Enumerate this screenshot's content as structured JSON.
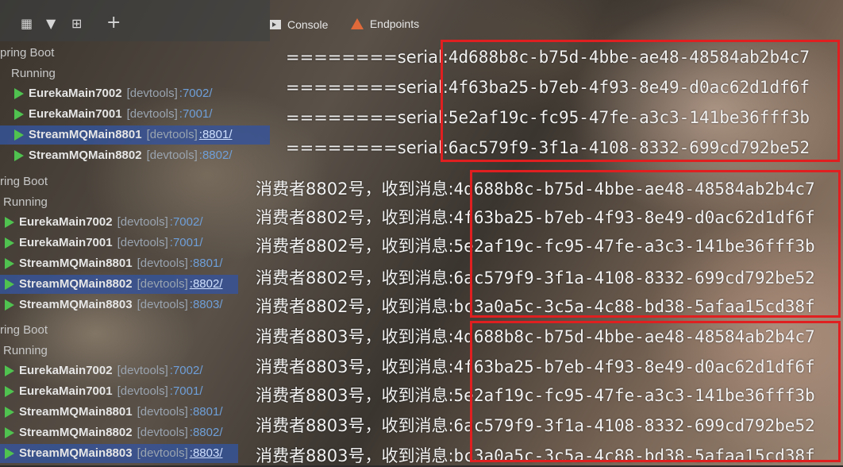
{
  "tabs": {
    "console": "Console",
    "endpoints": "Endpoints"
  },
  "toolbar_icons": [
    "layout-icon",
    "filter-icon",
    "add-config-icon",
    "plus-icon"
  ],
  "toolbar": {
    "plus_glyph": "+"
  },
  "panel1": {
    "group": "pring Boot",
    "running": "Running",
    "items": [
      {
        "name": "EurekaMain7002",
        "dev": "[devtools]",
        "port": ":7002/",
        "selected": false
      },
      {
        "name": "EurekaMain7001",
        "dev": "[devtools]",
        "port": ":7001/",
        "selected": false
      },
      {
        "name": "StreamMQMain8801",
        "dev": "[devtools]",
        "port": ":8801/",
        "selected": true
      },
      {
        "name": "StreamMQMain8802",
        "dev": "[devtools]",
        "port": ":8802/",
        "selected": false
      }
    ]
  },
  "panel2": {
    "group": "ring Boot",
    "running": "Running",
    "items": [
      {
        "name": "EurekaMain7002",
        "dev": "[devtools]",
        "port": ":7002/",
        "selected": false
      },
      {
        "name": "EurekaMain7001",
        "dev": "[devtools]",
        "port": ":7001/",
        "selected": false
      },
      {
        "name": "StreamMQMain8801",
        "dev": "[devtools]",
        "port": ":8801/",
        "selected": false
      },
      {
        "name": "StreamMQMain8802",
        "dev": "[devtools]",
        "port": ":8802/",
        "selected": true
      },
      {
        "name": "StreamMQMain8803",
        "dev": "[devtools]",
        "port": ":8803/",
        "selected": false
      }
    ]
  },
  "panel3": {
    "group": "ring Boot",
    "running": "Running",
    "items": [
      {
        "name": "EurekaMain7002",
        "dev": "[devtools]",
        "port": ":7002/",
        "selected": false
      },
      {
        "name": "EurekaMain7001",
        "dev": "[devtools]",
        "port": ":7001/",
        "selected": false
      },
      {
        "name": "StreamMQMain8801",
        "dev": "[devtools]",
        "port": ":8801/",
        "selected": false
      },
      {
        "name": "StreamMQMain8802",
        "dev": "[devtools]",
        "port": ":8802/",
        "selected": false
      },
      {
        "name": "StreamMQMain8803",
        "dev": "[devtools]",
        "port": ":8803/",
        "selected": true
      }
    ]
  },
  "section1": {
    "prefix": "========serial:",
    "values": [
      "4d688b8c-b75d-4bbe-ae48-48584ab2b4c7",
      "4f63ba25-b7eb-4f93-8e49-d0ac62d1df6f",
      "5e2af19c-fc95-47fe-a3c3-141be36fff3b",
      "6ac579f9-3f1a-4108-8332-699cd792be52"
    ]
  },
  "section2": {
    "prefix": "消费者8802号，收到消息:",
    "values": [
      "4d688b8c-b75d-4bbe-ae48-48584ab2b4c7",
      "4f63ba25-b7eb-4f93-8e49-d0ac62d1df6f",
      "5e2af19c-fc95-47fe-a3c3-141be36fff3b",
      "6ac579f9-3f1a-4108-8332-699cd792be52",
      "bc3a0a5c-3c5a-4c88-bd38-5afaa15cd38f"
    ]
  },
  "section3": {
    "prefix": "消费者8803号，收到消息:",
    "values": [
      "4d688b8c-b75d-4bbe-ae48-48584ab2b4c7",
      "4f63ba25-b7eb-4f93-8e49-d0ac62d1df6f",
      "5e2af19c-fc95-47fe-a3c3-141be36fff3b",
      "6ac579f9-3f1a-4108-8332-699cd792be52",
      "bc3a0a5c-3c5a-4c88-bd38-5afaa15cd38f"
    ]
  },
  "colors": {
    "highlight": "#e02020",
    "selected_row": "#365496",
    "run_icon": "#4fc24f",
    "port_link": "#6f9fd8"
  }
}
